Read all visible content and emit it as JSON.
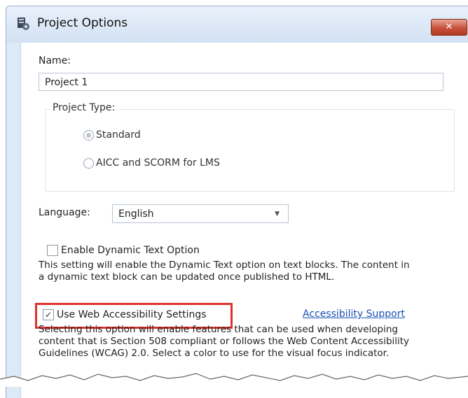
{
  "window": {
    "title": "Project Options",
    "close_label": "✕"
  },
  "name_field": {
    "label": "Name:",
    "value": "Project 1"
  },
  "project_type": {
    "legend": "Project Type:",
    "options": [
      "Standard",
      "AICC and SCORM for LMS"
    ],
    "selected": "Standard"
  },
  "language": {
    "label": "Language:",
    "value": "English"
  },
  "dynamic_text": {
    "label": "Enable Dynamic Text Option",
    "checked": false,
    "desc_line1": "This setting will enable the Dynamic Text option on text blocks. The content in",
    "desc_line2": "a dynamic text block can be updated once published to HTML."
  },
  "web_accessibility": {
    "label": "Use Web Accessibility Settings",
    "checked": true,
    "link": "Accessibility Support",
    "desc_line1": "Selecting this option will enable features that can be used when developing",
    "desc_line2": "content that is Section 508 compliant or follows the Web Content Accessibility",
    "desc_line3": "Guidelines (WCAG) 2.0. Select a color to use for the visual focus indicator."
  },
  "colors": {
    "accent_link": "#1a4fb5",
    "highlight_box": "#e0322e",
    "close_button": "#c7503a"
  },
  "icons": {
    "app": "project-options-app-icon",
    "close": "close-icon",
    "dropdown": "chevron-down-icon"
  }
}
